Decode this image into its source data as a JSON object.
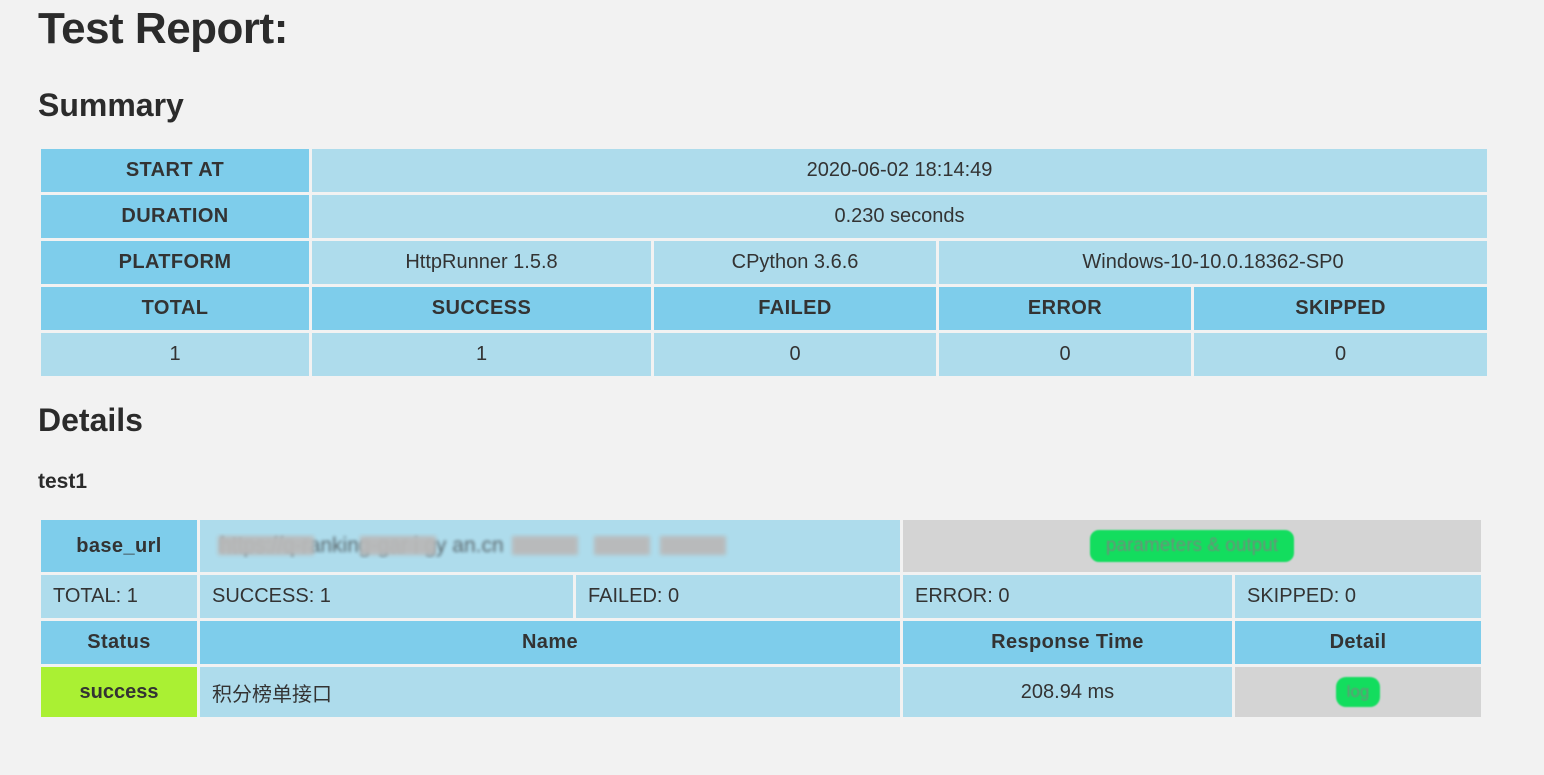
{
  "page": {
    "title": "Test Report:",
    "summary_heading": "Summary",
    "details_heading": "Details",
    "background_color": "#f2f2f2"
  },
  "colors": {
    "header_blue": "#7ecdeb",
    "cell_blue": "#aedcec",
    "gray_cell": "#d4d4d4",
    "success_green": "#aaf033",
    "badge_green": "#13dd5e"
  },
  "summary": {
    "rows": [
      {
        "label": "START AT",
        "value": "2020-06-02 18:14:49"
      },
      {
        "label": "DURATION",
        "value": "0.230 seconds"
      }
    ],
    "platform": {
      "label": "PLATFORM",
      "runner": "HttpRunner 1.5.8",
      "python": "CPython 3.6.6",
      "os": "Windows-10-10.0.18362-SP0"
    },
    "stats_headers": [
      "TOTAL",
      "SUCCESS",
      "FAILED",
      "ERROR",
      "SKIPPED"
    ],
    "stats_values": [
      "1",
      "1",
      "0",
      "0",
      "0"
    ]
  },
  "details": {
    "case_name": "test1",
    "base_url_label": "base_url",
    "base_url_value": "https://q-ranking-gar  i  gy   an.cn",
    "parameters_output_label": "parameters & output",
    "counts": [
      "TOTAL: 1",
      "SUCCESS: 1",
      "FAILED: 0",
      "ERROR: 0",
      "SKIPPED: 0"
    ],
    "table_headers": [
      "Status",
      "Name",
      "Response Time",
      "Detail"
    ],
    "rows": [
      {
        "status": "success",
        "name": "积分榜单接口",
        "response_time": "208.94 ms",
        "detail_label": "log"
      }
    ]
  }
}
